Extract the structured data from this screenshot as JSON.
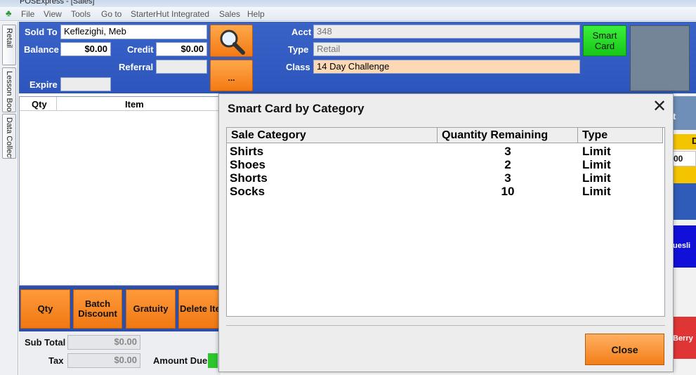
{
  "window": {
    "title": "POSExpress - [Sales]"
  },
  "menu": {
    "items": [
      "File",
      "View",
      "Tools",
      "Go to",
      "StarterHut Integrated",
      "Sales",
      "Help"
    ]
  },
  "side_tabs": [
    "Retail",
    "Lesson Booking",
    "Data Collection"
  ],
  "customer": {
    "sold_to_label": "Sold To",
    "sold_to": "Keflezighi, Meb",
    "balance_label": "Balance",
    "balance": "$0.00",
    "credit_label": "Credit",
    "credit": "$0.00",
    "referral_label": "Referral",
    "referral": "",
    "expire_label": "Expire",
    "expire": "",
    "acct_label": "Acct",
    "acct": "348",
    "type_label": "Type",
    "type": "Retail",
    "class_label": "Class",
    "class": "14 Day Challenge",
    "more_button": "...",
    "smart_card_button": "Smart Card"
  },
  "grid": {
    "columns": [
      "Qty",
      "Item"
    ]
  },
  "actions": [
    "Qty",
    "Batch Discount",
    "Gratuity",
    "Delete Item"
  ],
  "totals": {
    "subtotal_label": "Sub Total",
    "subtotal": "$0.00",
    "tax_label": "Tax",
    "tax": "$0.00",
    "amount_due_label": "Amount Due"
  },
  "right_strip": {
    "partial_00": "00",
    "partial_d": "D",
    "muesli": "uesli",
    "berry": "Berry",
    "partial_t": "t"
  },
  "modal": {
    "title": "Smart Card by Category",
    "columns": [
      "Sale Category",
      "Quantity Remaining",
      "Type"
    ],
    "rows": [
      {
        "category": "Shirts",
        "qty": "3",
        "type": "Limit"
      },
      {
        "category": "Shoes",
        "qty": "2",
        "type": "Limit"
      },
      {
        "category": "Shorts",
        "qty": "3",
        "type": "Limit"
      },
      {
        "category": "Socks",
        "qty": "10",
        "type": "Limit"
      }
    ],
    "close_label": "Close"
  },
  "colors": {
    "header_blue": "#2d56bd",
    "orange": "#f37a14",
    "green": "#17c617",
    "peach": "#fcd8b4"
  }
}
